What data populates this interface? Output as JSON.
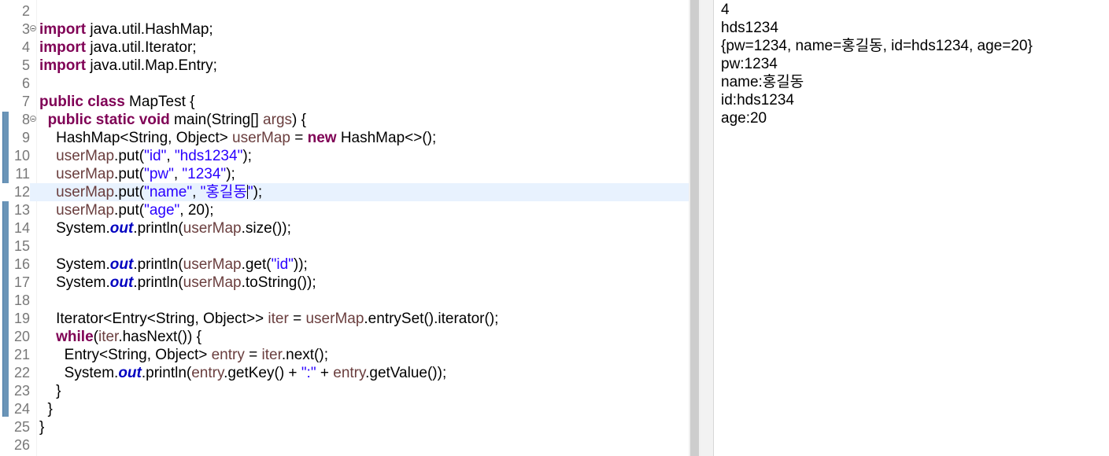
{
  "editor": {
    "lines": [
      {
        "no": "2",
        "fold": false,
        "tokens": []
      },
      {
        "no": "3",
        "fold": true,
        "tokens": [
          [
            "kw",
            "import"
          ],
          [
            "plain",
            " java.util.HashMap;"
          ]
        ]
      },
      {
        "no": "4",
        "fold": false,
        "tokens": [
          [
            "kw",
            "import"
          ],
          [
            "plain",
            " java.util.Iterator;"
          ]
        ]
      },
      {
        "no": "5",
        "fold": false,
        "tokens": [
          [
            "kw",
            "import"
          ],
          [
            "plain",
            " java.util.Map.Entry;"
          ]
        ]
      },
      {
        "no": "6",
        "fold": false,
        "tokens": []
      },
      {
        "no": "7",
        "fold": false,
        "tokens": [
          [
            "kw",
            "public"
          ],
          [
            "plain",
            " "
          ],
          [
            "kw",
            "class"
          ],
          [
            "plain",
            " MapTest {"
          ]
        ]
      },
      {
        "no": "8",
        "fold": true,
        "tokens": [
          [
            "plain",
            "  "
          ],
          [
            "kw",
            "public"
          ],
          [
            "plain",
            " "
          ],
          [
            "kw",
            "static"
          ],
          [
            "plain",
            " "
          ],
          [
            "kw",
            "void"
          ],
          [
            "plain",
            " main(String[] "
          ],
          [
            "var",
            "args"
          ],
          [
            "plain",
            ") {"
          ]
        ]
      },
      {
        "no": "9",
        "fold": false,
        "tokens": [
          [
            "plain",
            "    HashMap<String, Object> "
          ],
          [
            "var",
            "userMap"
          ],
          [
            "plain",
            " = "
          ],
          [
            "kw",
            "new"
          ],
          [
            "plain",
            " HashMap<>();"
          ]
        ]
      },
      {
        "no": "10",
        "fold": false,
        "tokens": [
          [
            "plain",
            "    "
          ],
          [
            "var",
            "userMap"
          ],
          [
            "plain",
            ".put("
          ],
          [
            "str",
            "\"id\""
          ],
          [
            "plain",
            ", "
          ],
          [
            "str",
            "\"hds1234\""
          ],
          [
            "plain",
            ");"
          ]
        ]
      },
      {
        "no": "11",
        "fold": false,
        "tokens": [
          [
            "plain",
            "    "
          ],
          [
            "var",
            "userMap"
          ],
          [
            "plain",
            ".put("
          ],
          [
            "str",
            "\"pw\""
          ],
          [
            "plain",
            ", "
          ],
          [
            "str",
            "\"1234\""
          ],
          [
            "plain",
            ");"
          ]
        ]
      },
      {
        "no": "12",
        "fold": false,
        "current": true,
        "tokens": [
          [
            "plain",
            "    "
          ],
          [
            "var",
            "userMap"
          ],
          [
            "plain",
            ".put("
          ],
          [
            "str",
            "\"name\""
          ],
          [
            "plain",
            ", "
          ],
          [
            "str",
            "\"홍길동"
          ],
          [
            "caret",
            ""
          ],
          [
            "str",
            "\""
          ],
          [
            "plain",
            ");"
          ]
        ]
      },
      {
        "no": "13",
        "fold": false,
        "tokens": [
          [
            "plain",
            "    "
          ],
          [
            "var",
            "userMap"
          ],
          [
            "plain",
            ".put("
          ],
          [
            "str",
            "\"age\""
          ],
          [
            "plain",
            ", 20);"
          ]
        ]
      },
      {
        "no": "14",
        "fold": false,
        "tokens": [
          [
            "plain",
            "    System."
          ],
          [
            "static",
            "out"
          ],
          [
            "plain",
            ".println("
          ],
          [
            "var",
            "userMap"
          ],
          [
            "plain",
            ".size());"
          ]
        ]
      },
      {
        "no": "15",
        "fold": false,
        "tokens": []
      },
      {
        "no": "16",
        "fold": false,
        "tokens": [
          [
            "plain",
            "    System."
          ],
          [
            "static",
            "out"
          ],
          [
            "plain",
            ".println("
          ],
          [
            "var",
            "userMap"
          ],
          [
            "plain",
            ".get("
          ],
          [
            "str",
            "\"id\""
          ],
          [
            "plain",
            "));"
          ]
        ]
      },
      {
        "no": "17",
        "fold": false,
        "tokens": [
          [
            "plain",
            "    System."
          ],
          [
            "static",
            "out"
          ],
          [
            "plain",
            ".println("
          ],
          [
            "var",
            "userMap"
          ],
          [
            "plain",
            ".toString());"
          ]
        ]
      },
      {
        "no": "18",
        "fold": false,
        "tokens": []
      },
      {
        "no": "19",
        "fold": false,
        "tokens": [
          [
            "plain",
            "    Iterator<Entry<String, Object>> "
          ],
          [
            "var",
            "iter"
          ],
          [
            "plain",
            " = "
          ],
          [
            "var",
            "userMap"
          ],
          [
            "plain",
            ".entrySet().iterator();"
          ]
        ]
      },
      {
        "no": "20",
        "fold": false,
        "tokens": [
          [
            "plain",
            "    "
          ],
          [
            "kw",
            "while"
          ],
          [
            "plain",
            "("
          ],
          [
            "var",
            "iter"
          ],
          [
            "plain",
            ".hasNext()) {"
          ]
        ]
      },
      {
        "no": "21",
        "fold": false,
        "tokens": [
          [
            "plain",
            "      Entry<String, Object> "
          ],
          [
            "var",
            "entry"
          ],
          [
            "plain",
            " = "
          ],
          [
            "var",
            "iter"
          ],
          [
            "plain",
            ".next();"
          ]
        ]
      },
      {
        "no": "22",
        "fold": false,
        "tokens": [
          [
            "plain",
            "      System."
          ],
          [
            "static",
            "out"
          ],
          [
            "plain",
            ".println("
          ],
          [
            "var",
            "entry"
          ],
          [
            "plain",
            ".getKey() + "
          ],
          [
            "str",
            "\":\""
          ],
          [
            "plain",
            " + "
          ],
          [
            "var",
            "entry"
          ],
          [
            "plain",
            ".getValue());"
          ]
        ]
      },
      {
        "no": "23",
        "fold": false,
        "tokens": [
          [
            "plain",
            "    }"
          ]
        ]
      },
      {
        "no": "24",
        "fold": false,
        "tokens": [
          [
            "plain",
            "  }"
          ]
        ]
      },
      {
        "no": "25",
        "fold": false,
        "tokens": [
          [
            "plain",
            "}"
          ]
        ]
      },
      {
        "no": "26",
        "fold": false,
        "tokens": []
      }
    ]
  },
  "console": {
    "lines": [
      "4",
      "hds1234",
      "{pw=1234, name=홍길동, id=hds1234, age=20}",
      "pw:1234",
      "name:홍길동",
      "id:hds1234",
      "age:20"
    ]
  }
}
